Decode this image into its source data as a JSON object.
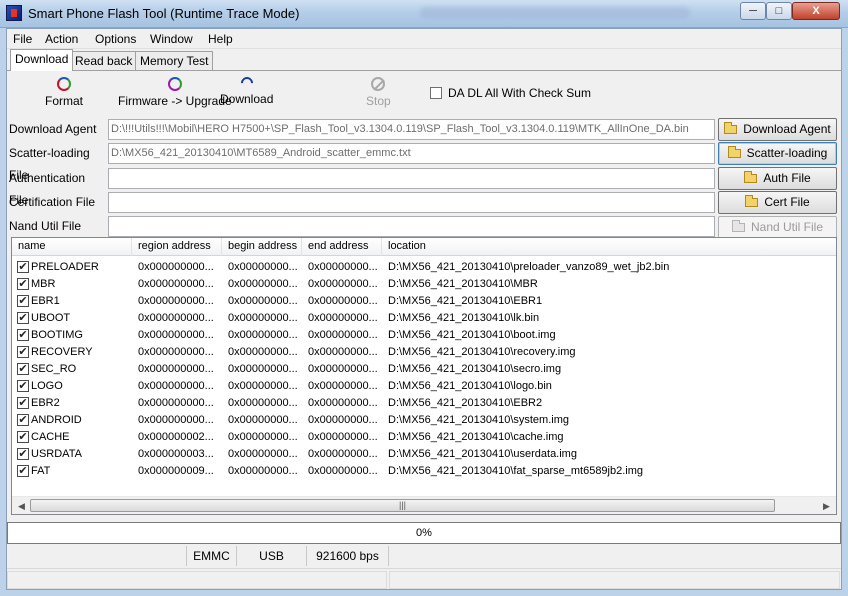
{
  "window": {
    "title": "Smart Phone Flash Tool (Runtime Trace Mode)",
    "controls": {
      "minimize": "─",
      "maximize": "□",
      "close": "X"
    }
  },
  "menu": [
    "File",
    "Action",
    "Options",
    "Window",
    "Help"
  ],
  "tabs": [
    "Download",
    "Read back",
    "Memory Test"
  ],
  "toolbar": {
    "format": "Format",
    "upgrade": "Firmware -> Upgrade",
    "download": "Download",
    "stop": "Stop",
    "checksum_label": "DA DL All With Check Sum"
  },
  "files": [
    {
      "label": "Download Agent",
      "value": "D:\\!!!Utils!!!\\Mobil\\HERO H7500+\\SP_Flash_Tool_v3.1304.0.119\\SP_Flash_Tool_v3.1304.0.119\\MTK_AllInOne_DA.bin",
      "button": "Download Agent"
    },
    {
      "label": "Scatter-loading File",
      "value": "D:\\MX56_421_20130410\\MT6589_Android_scatter_emmc.txt",
      "button": "Scatter-loading"
    },
    {
      "label": "Authentication File",
      "value": "",
      "button": "Auth File"
    },
    {
      "label": "Certification File",
      "value": "",
      "button": "Cert File"
    },
    {
      "label": "Nand Util File",
      "value": "",
      "button": "Nand Util File"
    }
  ],
  "list": {
    "columns": [
      "name",
      "region address",
      "begin address",
      "end address",
      "location"
    ],
    "rows": [
      {
        "name": "PRELOADER",
        "region": "0x000000000...",
        "begin": "0x00000000...",
        "end": "0x00000000...",
        "location": "D:\\MX56_421_20130410\\preloader_vanzo89_wet_jb2.bin"
      },
      {
        "name": "MBR",
        "region": "0x000000000...",
        "begin": "0x00000000...",
        "end": "0x00000000...",
        "location": "D:\\MX56_421_20130410\\MBR"
      },
      {
        "name": "EBR1",
        "region": "0x000000000...",
        "begin": "0x00000000...",
        "end": "0x00000000...",
        "location": "D:\\MX56_421_20130410\\EBR1"
      },
      {
        "name": "UBOOT",
        "region": "0x000000000...",
        "begin": "0x00000000...",
        "end": "0x00000000...",
        "location": "D:\\MX56_421_20130410\\lk.bin"
      },
      {
        "name": "BOOTIMG",
        "region": "0x000000000...",
        "begin": "0x00000000...",
        "end": "0x00000000...",
        "location": "D:\\MX56_421_20130410\\boot.img"
      },
      {
        "name": "RECOVERY",
        "region": "0x000000000...",
        "begin": "0x00000000...",
        "end": "0x00000000...",
        "location": "D:\\MX56_421_20130410\\recovery.img"
      },
      {
        "name": "SEC_RO",
        "region": "0x000000000...",
        "begin": "0x00000000...",
        "end": "0x00000000...",
        "location": "D:\\MX56_421_20130410\\secro.img"
      },
      {
        "name": "LOGO",
        "region": "0x000000000...",
        "begin": "0x00000000...",
        "end": "0x00000000...",
        "location": "D:\\MX56_421_20130410\\logo.bin"
      },
      {
        "name": "EBR2",
        "region": "0x000000000...",
        "begin": "0x00000000...",
        "end": "0x00000000...",
        "location": "D:\\MX56_421_20130410\\EBR2"
      },
      {
        "name": "ANDROID",
        "region": "0x000000000...",
        "begin": "0x00000000...",
        "end": "0x00000000...",
        "location": "D:\\MX56_421_20130410\\system.img"
      },
      {
        "name": "CACHE",
        "region": "0x000000002...",
        "begin": "0x00000000...",
        "end": "0x00000000...",
        "location": "D:\\MX56_421_20130410\\cache.img"
      },
      {
        "name": "USRDATA",
        "region": "0x000000003...",
        "begin": "0x00000000...",
        "end": "0x00000000...",
        "location": "D:\\MX56_421_20130410\\userdata.img"
      },
      {
        "name": "FAT",
        "region": "0x000000009...",
        "begin": "0x00000000...",
        "end": "0x00000000...",
        "location": "D:\\MX56_421_20130410\\fat_sparse_mt6589jb2.img"
      }
    ],
    "scroll_grip": "|||",
    "scroll_left": "◀",
    "scroll_right": "▶"
  },
  "progress": {
    "text": "0%"
  },
  "status": {
    "storage": "EMMC",
    "port": "USB",
    "baud": "921600 bps"
  },
  "icons": {
    "app": "flash-tool-icon",
    "format": "format-icon",
    "upgrade": "upgrade-icon",
    "download": "download-icon",
    "stop": "stop-icon",
    "folder": "folder-icon"
  }
}
